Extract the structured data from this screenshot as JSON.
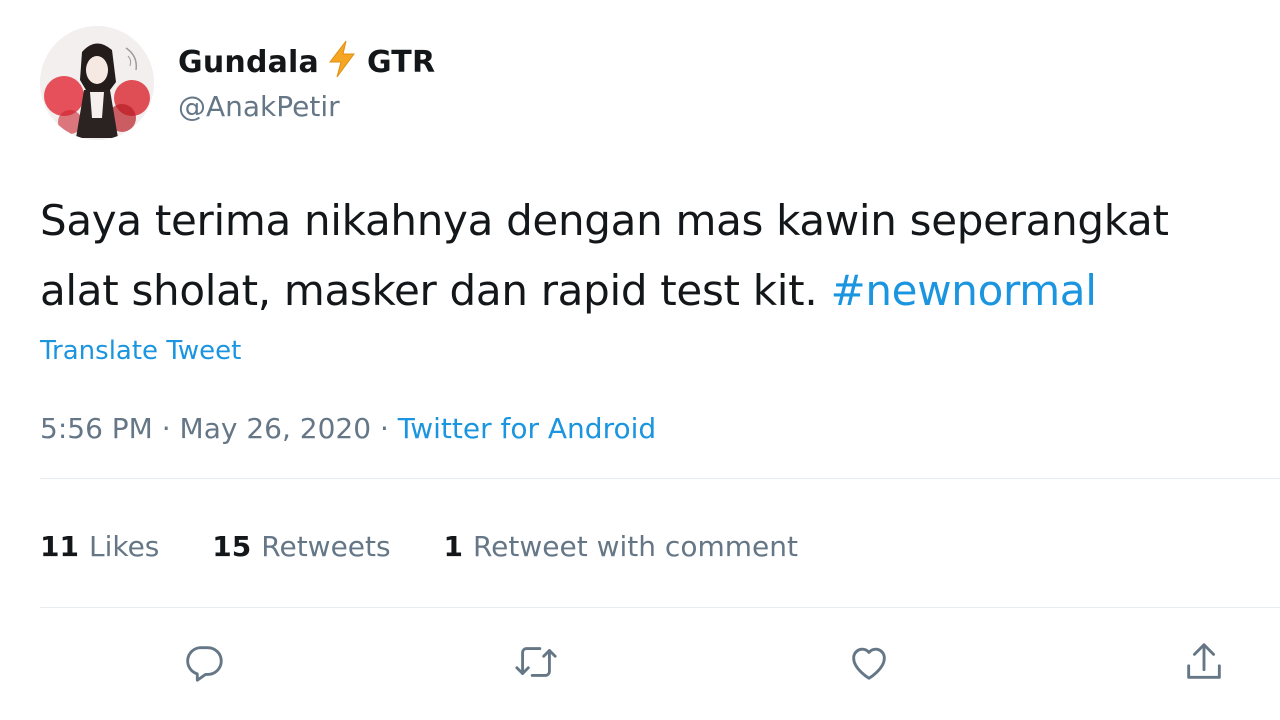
{
  "author": {
    "name_first": "Gundala",
    "name_emoji": "bolt-emoji",
    "name_last": "GTR",
    "handle": "@AnakPetir"
  },
  "tweet": {
    "line1": "Saya terima nikahnya dengan mas kawin seperangkat",
    "line2": "alat sholat, masker dan rapid test kit.",
    "hashtag": "#newnormal",
    "translate_label": "Translate Tweet"
  },
  "meta": {
    "time": "5:56 PM",
    "date": "May 26, 2020",
    "separator": "·",
    "source": "Twitter for Android"
  },
  "stats": {
    "likes_count": "11",
    "likes_label": "Likes",
    "retweets_count": "15",
    "retweets_label": "Retweets",
    "quotes_count": "1",
    "quotes_label": "Retweet with comment"
  },
  "actions": [
    "reply-icon",
    "retweet-icon",
    "like-icon",
    "share-icon"
  ],
  "colors": {
    "text": "#14171a",
    "secondary": "#657786",
    "link": "#1b95e0",
    "divider": "#e6ecf0",
    "bolt": "#f5a623"
  }
}
